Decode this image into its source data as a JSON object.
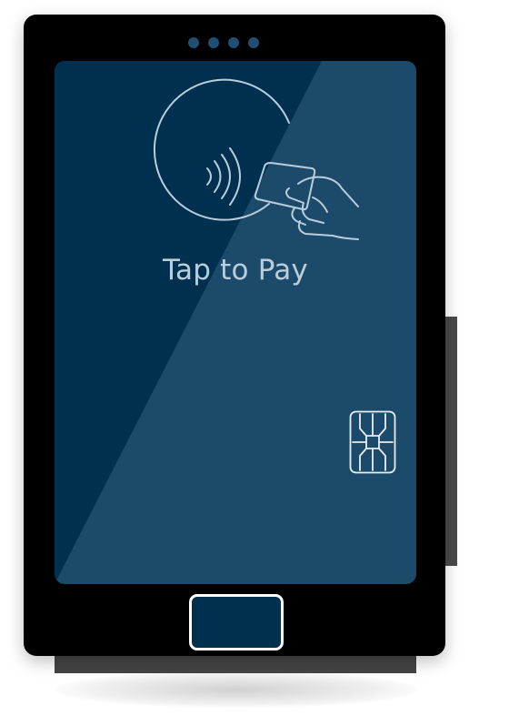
{
  "screen": {
    "prompt": "Tap to Pay"
  },
  "icons": {
    "contactless": "contactless-icon",
    "hand_card": "hand-holding-card-icon",
    "chip": "emv-chip-icon"
  },
  "colors": {
    "device_body": "#000000",
    "screen_dark": "#003050",
    "screen_light": "#1c4a6b",
    "indicator_dots": "#1f4f75",
    "line_art": "#b9cddb",
    "home_button_fill": "#00304f",
    "home_button_border": "#ffffff",
    "base": "#444444"
  }
}
